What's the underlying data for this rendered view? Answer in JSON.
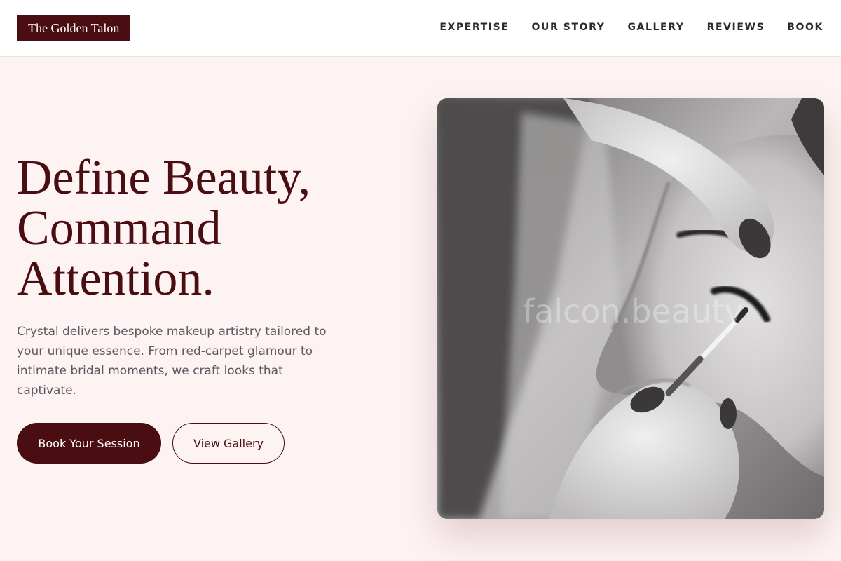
{
  "brand": {
    "name": "The Golden Talon"
  },
  "nav": {
    "items": [
      {
        "label": "EXPERTISE"
      },
      {
        "label": "OUR STORY"
      },
      {
        "label": "GALLERY"
      },
      {
        "label": "REVIEWS"
      },
      {
        "label": "BOOK"
      }
    ]
  },
  "hero": {
    "title_lines": [
      "Define Beauty,",
      "Command",
      "Attention."
    ],
    "description": "Crystal delivers bespoke makeup artistry tailored to your unique essence. From red-carpet glamour to intimate bridal moments, we craft looks that captivate.",
    "primary_button": "Book Your Session",
    "secondary_button": "View Gallery",
    "image": {
      "subject": "makeup-artist-applying-eyeshadow-photo",
      "watermark": "falcon.beauty"
    }
  },
  "colors": {
    "accent": "#4a0e12",
    "page_background": "#fdf3f2",
    "header_background": "#ffffff",
    "nav_text": "#2c2a2e",
    "body_text": "#5c5862"
  }
}
